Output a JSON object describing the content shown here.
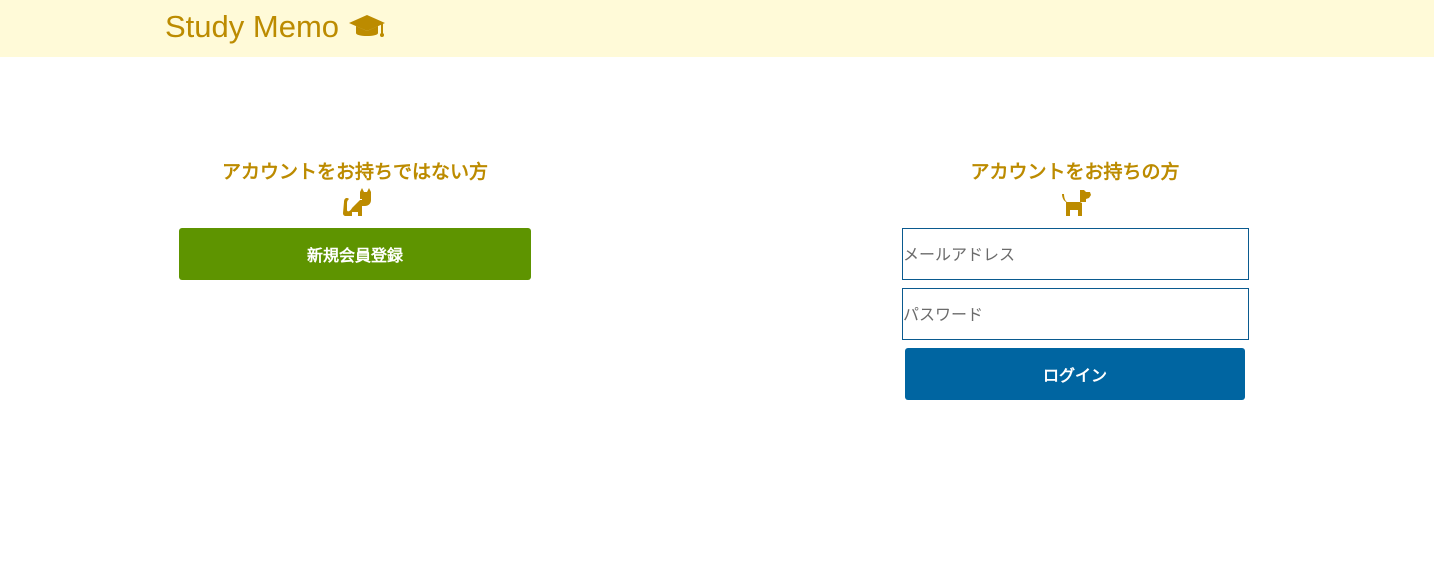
{
  "header": {
    "title": "Study Memo",
    "icon": "graduation-cap-icon"
  },
  "signup": {
    "heading": "アカウントをお持ちではない方",
    "icon": "cat-icon",
    "button_label": "新規会員登録"
  },
  "login": {
    "heading": "アカウントをお持ちの方",
    "icon": "dog-icon",
    "email_placeholder": "メールアドレス",
    "email_value": "",
    "password_placeholder": "パスワード",
    "password_value": "",
    "button_label": "ログイン"
  },
  "colors": {
    "accent": "#bc8b00",
    "header_bg": "#fffad8",
    "register_button": "#5e9400",
    "login_button": "#0065a1",
    "input_border": "#0a5a8f"
  }
}
